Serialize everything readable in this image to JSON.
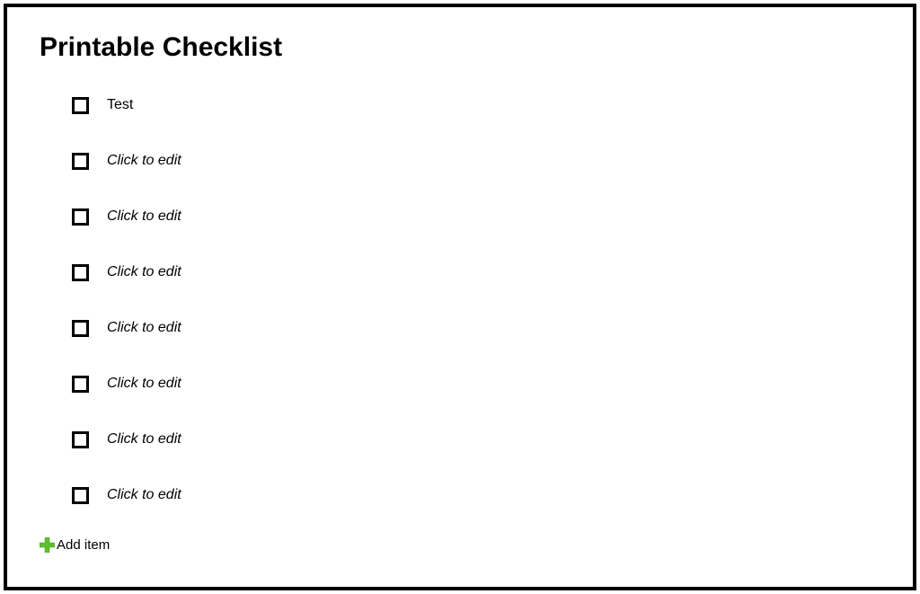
{
  "title": "Printable Checklist",
  "placeholder_text": "Click to edit",
  "items": [
    {
      "text": "Test",
      "is_placeholder": false
    },
    {
      "text": "Click to edit",
      "is_placeholder": true
    },
    {
      "text": "Click to edit",
      "is_placeholder": true
    },
    {
      "text": "Click to edit",
      "is_placeholder": true
    },
    {
      "text": "Click to edit",
      "is_placeholder": true
    },
    {
      "text": "Click to edit",
      "is_placeholder": true
    },
    {
      "text": "Click to edit",
      "is_placeholder": true
    },
    {
      "text": "Click to edit",
      "is_placeholder": true
    }
  ],
  "add_item_label": "Add item"
}
